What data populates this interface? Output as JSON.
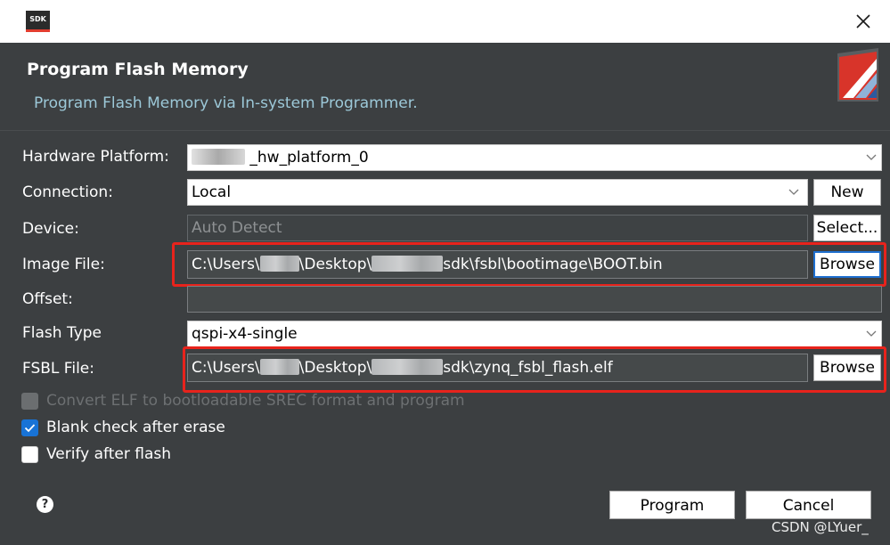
{
  "window": {
    "app_icon_text": "SDK",
    "close_glyph": "✕"
  },
  "header": {
    "title": "Program Flash Memory",
    "subtitle": "Program Flash Memory via In-system Programmer."
  },
  "form": {
    "hardware_platform": {
      "label": "Hardware Platform:",
      "value_suffix": "_hw_platform_0"
    },
    "connection": {
      "label": "Connection:",
      "value": "Local",
      "button": "New"
    },
    "device": {
      "label": "Device:",
      "value": "Auto Detect",
      "button": "Select..."
    },
    "image_file": {
      "label": "Image File:",
      "part1": "C:\\Users\\",
      "part2": "\\Desktop\\",
      "part3": "sdk\\fsbl\\bootimage\\BOOT.bin",
      "button": "Browse"
    },
    "offset": {
      "label": "Offset:",
      "value": ""
    },
    "flash_type": {
      "label": "Flash Type",
      "value": "qspi-x4-single"
    },
    "fsbl_file": {
      "label": "FSBL File:",
      "part1": "C:\\Users\\",
      "part2": "\\Desktop\\",
      "part3": "sdk\\zynq_fsbl_flash.elf",
      "button": "Browse"
    }
  },
  "options": {
    "convert_elf": {
      "label": "Convert ELF to bootloadable SREC format and program",
      "checked": false,
      "enabled": false
    },
    "blank_check": {
      "label": "Blank check after erase",
      "checked": true,
      "enabled": true
    },
    "verify": {
      "label": "Verify after flash",
      "checked": false,
      "enabled": true
    }
  },
  "footer": {
    "help_glyph": "?",
    "program_button": "Program",
    "cancel_button": "Cancel"
  },
  "watermark": "CSDN @LYuer_",
  "colors": {
    "dialog_background": "#3c3f41",
    "subtitle": "#9cc8d8",
    "highlight_box": "#e8231c",
    "checkbox_checked": "#1873d6"
  },
  "icons": [
    "close-icon",
    "chevron-down-icon",
    "checkmark-icon",
    "help-icon",
    "sdk-logo-icon",
    "header-logo-icon"
  ]
}
